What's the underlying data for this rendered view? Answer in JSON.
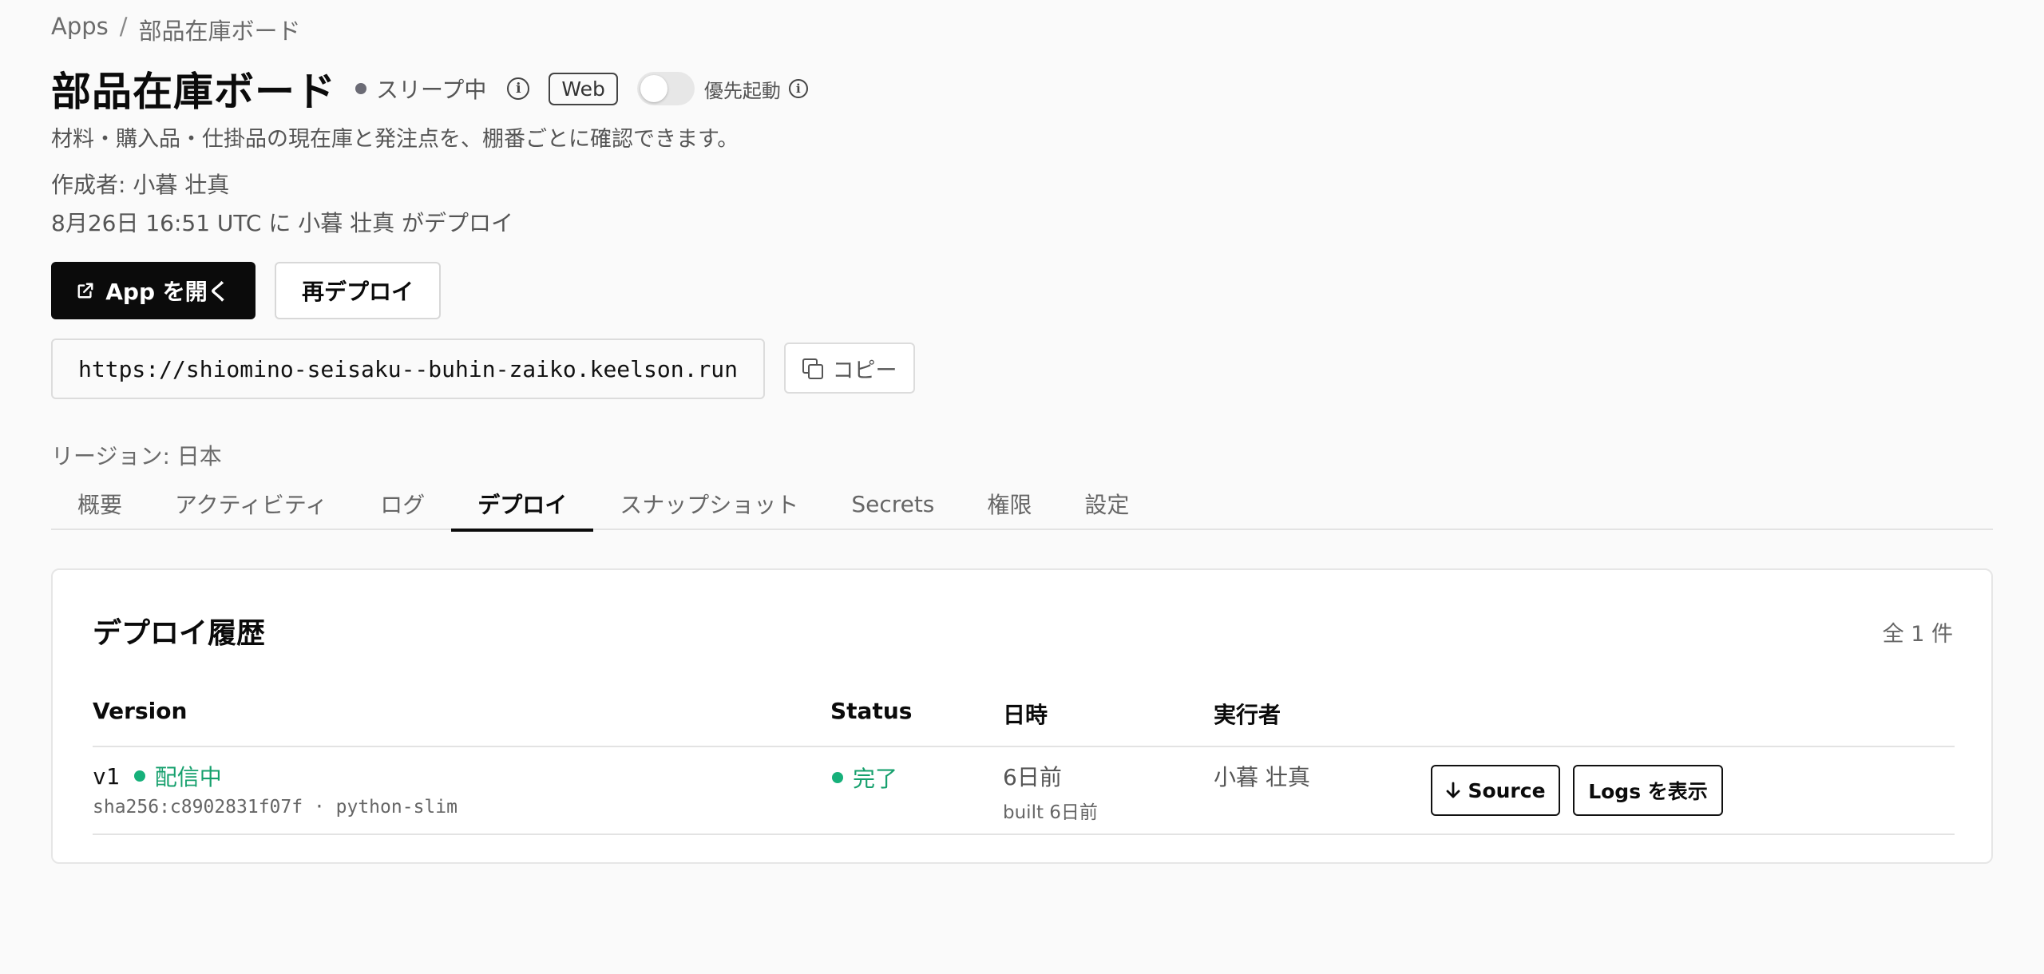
{
  "breadcrumb": {
    "root": "Apps",
    "separator": "/",
    "current": "部品在庫ボード"
  },
  "app": {
    "title": "部品在庫ボード",
    "status": "スリープ中",
    "badge": "Web",
    "priority_label": "優先起動",
    "priority_enabled": false,
    "description": "材料・購入品・仕掛品の現在庫と発注点を、棚番ごとに確認できます。",
    "author": "作成者: 小暮 壮真",
    "deployed": "8月26日 16:51 UTC に 小暮 壮真 がデプロイ"
  },
  "actions": {
    "open": "App を開く",
    "redeploy": "再デプロイ"
  },
  "url": {
    "value": "https://shiomino-seisaku--buhin-zaiko.keelson.run",
    "copy": "コピー"
  },
  "region": "リージョン: 日本",
  "tabs": [
    {
      "label": "概要"
    },
    {
      "label": "アクティビティ"
    },
    {
      "label": "ログ"
    },
    {
      "label": "デプロイ",
      "active": true
    },
    {
      "label": "スナップショット"
    },
    {
      "label": "Secrets"
    },
    {
      "label": "権限"
    },
    {
      "label": "設定"
    }
  ],
  "history": {
    "title": "デプロイ履歴",
    "count": "全 1 件",
    "columns": {
      "version": "Version",
      "status": "Status",
      "date": "日時",
      "actor": "実行者"
    },
    "rows": [
      {
        "version": "v1",
        "live": "配信中",
        "sha": "sha256:c8902831f07f  · python-slim",
        "status": "完了",
        "date": "6日前",
        "built": "built 6日前",
        "actor": "小暮 壮真",
        "source_btn": "Source",
        "logs_btn": "Logs を表示"
      }
    ]
  },
  "colors": {
    "primary": "#0b0b0b",
    "success": "#16b07a",
    "sleep": "#6b6b75"
  }
}
